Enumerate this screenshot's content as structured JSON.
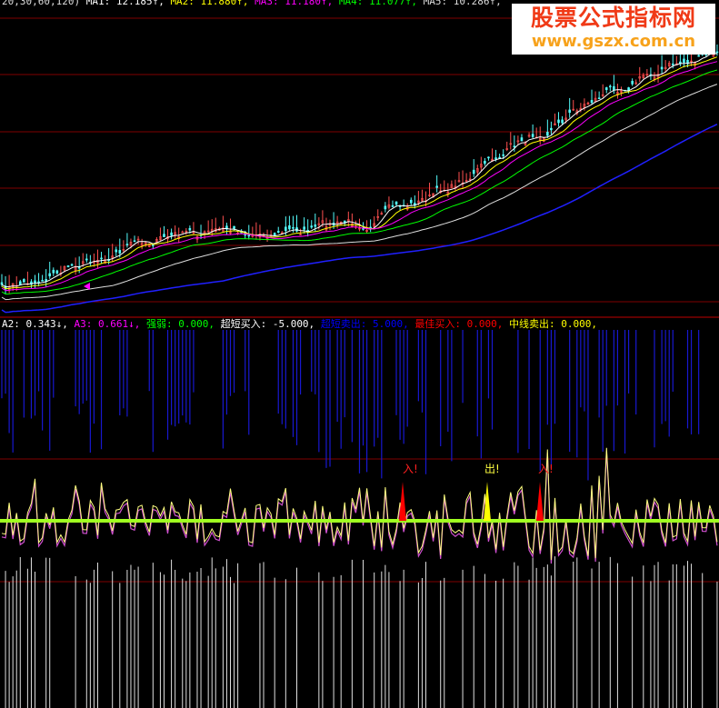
{
  "chart_data": {
    "type": "candlestick",
    "panes": [
      {
        "name": "main",
        "legend": [
          {
            "text": "20,30,60,120)",
            "color": "#dddddd"
          },
          {
            "text": "MA1: 12.185↑,",
            "color": "#ffffff"
          },
          {
            "text": "MA2: 11.880↑,",
            "color": "#ffff00"
          },
          {
            "text": "MA3: 11.180↑,",
            "color": "#ff00ff"
          },
          {
            "text": "MA4: 11.077↑,",
            "color": "#00ff00"
          },
          {
            "text": "MA5: 10.286↑,",
            "color": "#dddddd"
          }
        ],
        "trend": "rising",
        "grid": true
      },
      {
        "name": "indicator",
        "legend": [
          {
            "text": "A2: 0.343↓,",
            "color": "#ffffff"
          },
          {
            "text": "A3: 0.661↓,",
            "color": "#ff00ff"
          },
          {
            "text": "强弱: 0.000,",
            "color": "#00ff00"
          },
          {
            "text": "超短买入: -5.000,",
            "color": "#ffffff"
          },
          {
            "text": "超短卖出: 5.000,",
            "color": "#0000ff"
          },
          {
            "text": "最佳买入: 0.000,",
            "color": "#ff0000"
          },
          {
            "text": "中线卖出: 0.000,",
            "color": "#ffff00"
          }
        ],
        "signals": [
          {
            "label": "入!",
            "color": "#ff0000"
          },
          {
            "label": "出!",
            "color": "#ffff00"
          },
          {
            "label": "入!",
            "color": "#ff0000"
          }
        ]
      }
    ],
    "colors": {
      "background": "#000000",
      "grid": "#800000",
      "up": "#ff5050",
      "down": "#54fcfc",
      "ma_long": "#2020ff",
      "zero_line": "#a0ff20"
    }
  },
  "watermark": {
    "title": "股票公式指标网",
    "url": "www.gszx.com.cn"
  }
}
